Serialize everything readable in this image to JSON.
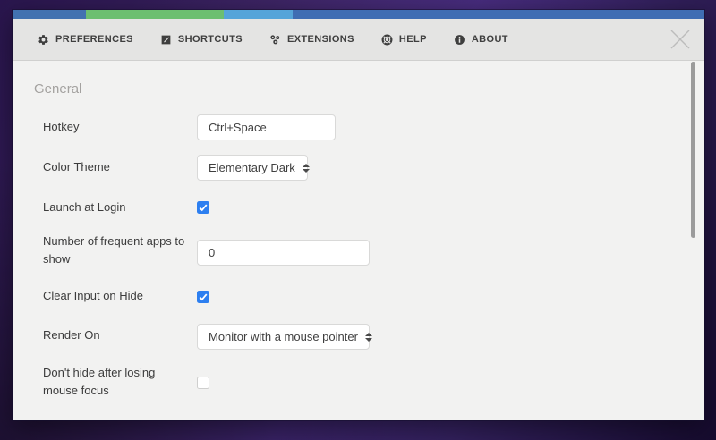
{
  "window": {
    "tabs": [
      {
        "label": "PREFERENCES",
        "icon": "gear-icon",
        "active": true
      },
      {
        "label": "SHORTCUTS",
        "icon": "edit-icon",
        "active": false
      },
      {
        "label": "EXTENSIONS",
        "icon": "extensions-icon",
        "active": false
      },
      {
        "label": "HELP",
        "icon": "lifebuoy-icon",
        "active": false
      },
      {
        "label": "ABOUT",
        "icon": "info-icon",
        "active": false
      }
    ],
    "close": {
      "icon": "close-icon"
    }
  },
  "general": {
    "section_title": "General",
    "rows": [
      {
        "label": "Hotkey",
        "type": "text-input",
        "value": "Ctrl+Space"
      },
      {
        "label": "Color Theme",
        "type": "select",
        "value": "Elementary Dark"
      },
      {
        "label": "Launch at Login",
        "type": "checkbox",
        "checked": true
      },
      {
        "label": "Number of frequent apps to show",
        "type": "text-input",
        "value": "0"
      },
      {
        "label": "Clear Input on Hide",
        "type": "checkbox",
        "checked": true
      },
      {
        "label": "Render On",
        "type": "select",
        "value": "Monitor with a mouse pointer"
      },
      {
        "label": "Don't hide after losing mouse focus",
        "type": "checkbox",
        "checked": false
      }
    ]
  },
  "colors": {
    "accent_checkbox": "#2d7ff0",
    "stripe_blue": "#4272b0",
    "stripe_green": "#6cbf70",
    "stripe_lightblue": "#55a4d9",
    "stripe_steelblue": "#3f6db3",
    "tabbar_bg": "#e4e4e3",
    "content_bg": "#f2f2f1",
    "desktop_purple": "#39215f"
  }
}
